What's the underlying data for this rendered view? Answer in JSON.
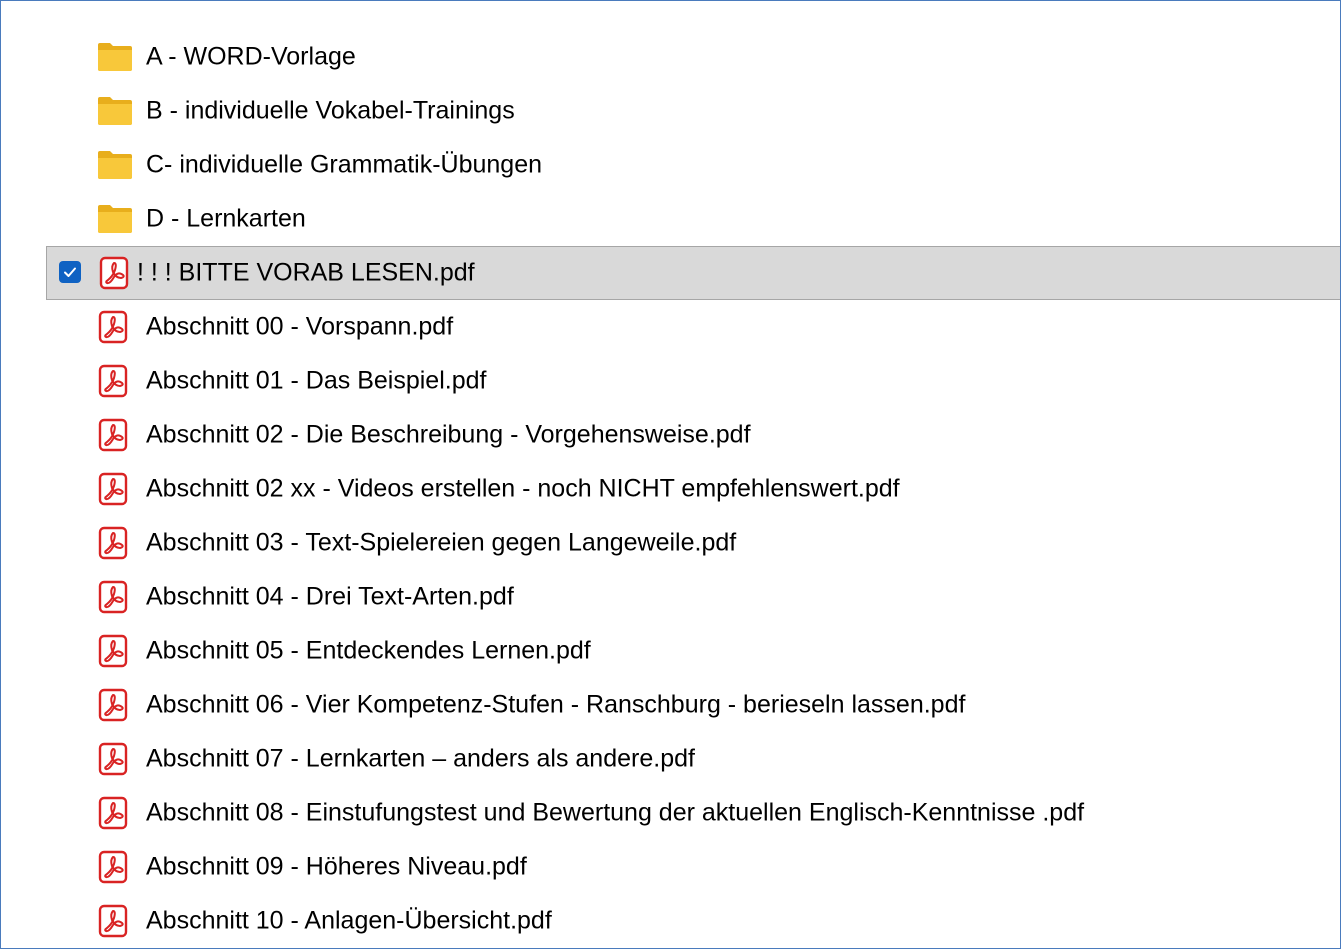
{
  "colors": {
    "folder": "#f5c02e",
    "pdf": "#d92323",
    "checkbox": "#0f62c3",
    "selection": "#d9d9d9",
    "frame_border": "#4a7bbd"
  },
  "folders": [
    {
      "name": "A - WORD-Vorlage",
      "icon": "folder-icon"
    },
    {
      "name": "B - individuelle Vokabel-Trainings",
      "icon": "folder-icon"
    },
    {
      "name": "C- individuelle Grammatik-Übungen",
      "icon": "folder-icon"
    },
    {
      "name": "D - Lernkarten",
      "icon": "folder-icon"
    }
  ],
  "selected_file": {
    "name": "! ! !  BITTE VORAB LESEN.pdf",
    "icon": "pdf-icon",
    "checked": true
  },
  "files": [
    {
      "name": "Abschnitt 00 - Vorspann.pdf",
      "icon": "pdf-icon"
    },
    {
      "name": "Abschnitt 01 - Das Beispiel.pdf",
      "icon": "pdf-icon"
    },
    {
      "name": "Abschnitt 02 - Die Beschreibung - Vorgehensweise.pdf",
      "icon": "pdf-icon"
    },
    {
      "name": "Abschnitt 02 xx - Videos erstellen - noch NICHT empfehlenswert.pdf",
      "icon": "pdf-icon"
    },
    {
      "name": "Abschnitt 03 - Text-Spielereien gegen Langeweile.pdf",
      "icon": "pdf-icon"
    },
    {
      "name": "Abschnitt 04 - Drei Text-Arten.pdf",
      "icon": "pdf-icon"
    },
    {
      "name": "Abschnitt 05 - Entdeckendes Lernen.pdf",
      "icon": "pdf-icon"
    },
    {
      "name": "Abschnitt 06 - Vier Kompetenz-Stufen - Ranschburg - berieseln lassen.pdf",
      "icon": "pdf-icon"
    },
    {
      "name": "Abschnitt 07 - Lernkarten – anders als andere.pdf",
      "icon": "pdf-icon"
    },
    {
      "name": "Abschnitt 08 - Einstufungstest und Bewertung der aktuellen Englisch-Kenntnisse .pdf",
      "icon": "pdf-icon"
    },
    {
      "name": "Abschnitt 09 - Höheres Niveau.pdf",
      "icon": "pdf-icon"
    },
    {
      "name": "Abschnitt 10 - Anlagen-Übersicht.pdf",
      "icon": "pdf-icon"
    }
  ]
}
